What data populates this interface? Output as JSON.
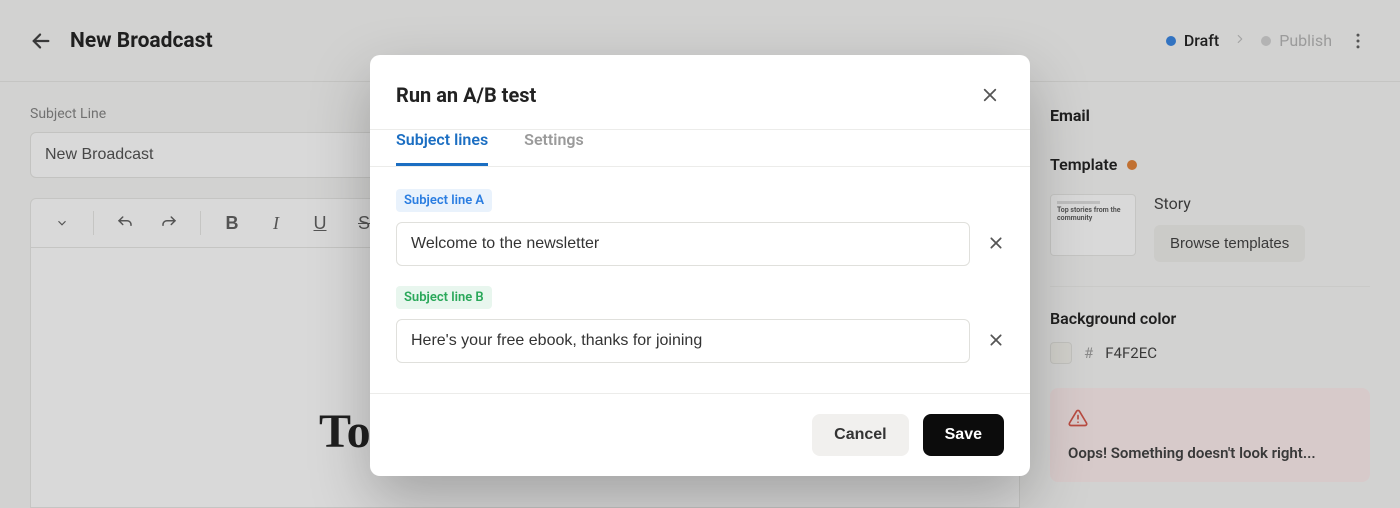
{
  "header": {
    "title": "New Broadcast",
    "draft_label": "Draft",
    "publish_label": "Publish"
  },
  "editor": {
    "subject_label": "Subject Line",
    "subject_value": "New Broadcast",
    "doc_heading": "Top stories from the"
  },
  "sidebar": {
    "email_heading": "Email",
    "template_label": "Template",
    "template_name": "Story",
    "browse_label": "Browse templates",
    "thumb_text": "Top stories from the community",
    "bgcolor_label": "Background color",
    "bgcolor_hex": "F4F2EC",
    "alert_text": "Oops! Something doesn't look right..."
  },
  "modal": {
    "title": "Run an A/B test",
    "tabs": {
      "subject": "Subject lines",
      "settings": "Settings"
    },
    "badge_a": "Subject line A",
    "badge_b": "Subject line B",
    "value_a": "Welcome to the newsletter",
    "value_b": "Here's your free ebook, thanks for joining",
    "cancel": "Cancel",
    "save": "Save"
  }
}
